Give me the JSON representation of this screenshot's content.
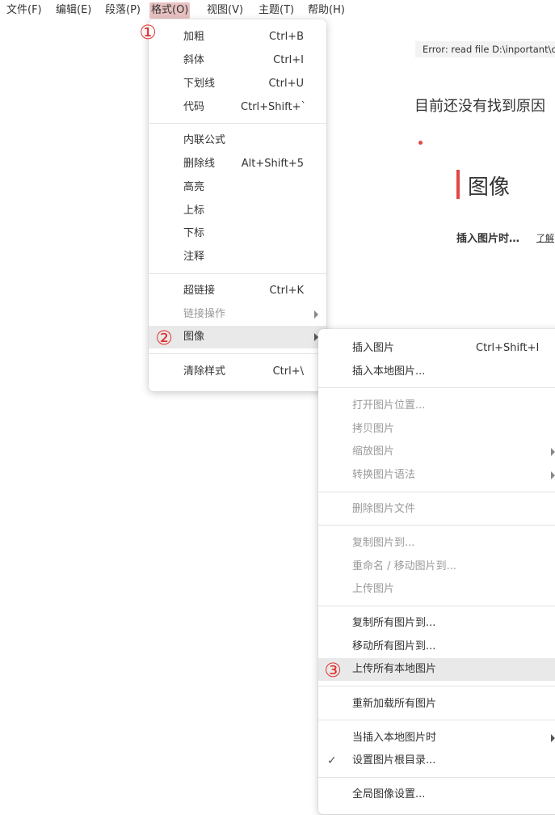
{
  "menubar": {
    "items": [
      {
        "label": "文件(F)"
      },
      {
        "label": "编辑(E)"
      },
      {
        "label": "段落(P)"
      },
      {
        "label": "格式(O)"
      },
      {
        "label": "视图(V)"
      },
      {
        "label": "主题(T)"
      },
      {
        "label": "帮助(H)"
      }
    ]
  },
  "editor": {
    "error_text": "Error: read file D:\\inportant\\c",
    "paragraph": "目前还没有找到原因",
    "heading": "图像",
    "insert_tip": "插入图片时…",
    "learn_more": "了解"
  },
  "format_menu": {
    "items": [
      {
        "label": "加粗",
        "shortcut": "Ctrl+B"
      },
      {
        "label": "斜体",
        "shortcut": "Ctrl+I"
      },
      {
        "label": "下划线",
        "shortcut": "Ctrl+U"
      },
      {
        "label": "代码",
        "shortcut": "Ctrl+Shift+`"
      },
      {
        "label": "内联公式",
        "shortcut": ""
      },
      {
        "label": "删除线",
        "shortcut": "Alt+Shift+5"
      },
      {
        "label": "高亮",
        "shortcut": ""
      },
      {
        "label": "上标",
        "shortcut": ""
      },
      {
        "label": "下标",
        "shortcut": ""
      },
      {
        "label": "注释",
        "shortcut": ""
      },
      {
        "label": "超链接",
        "shortcut": "Ctrl+K"
      },
      {
        "label": "链接操作",
        "shortcut": ""
      },
      {
        "label": "图像",
        "shortcut": ""
      },
      {
        "label": "清除样式",
        "shortcut": "Ctrl+\\"
      }
    ]
  },
  "image_menu": {
    "items": [
      {
        "label": "插入图片",
        "shortcut": "Ctrl+Shift+I"
      },
      {
        "label": "插入本地图片...",
        "shortcut": ""
      },
      {
        "label": "打开图片位置...",
        "shortcut": ""
      },
      {
        "label": "拷贝图片",
        "shortcut": ""
      },
      {
        "label": "缩放图片",
        "shortcut": ""
      },
      {
        "label": "转换图片语法",
        "shortcut": ""
      },
      {
        "label": "删除图片文件",
        "shortcut": ""
      },
      {
        "label": "复制图片到...",
        "shortcut": ""
      },
      {
        "label": "重命名 / 移动图片到...",
        "shortcut": ""
      },
      {
        "label": "上传图片",
        "shortcut": ""
      },
      {
        "label": "复制所有图片到...",
        "shortcut": ""
      },
      {
        "label": "移动所有图片到...",
        "shortcut": ""
      },
      {
        "label": "上传所有本地图片",
        "shortcut": ""
      },
      {
        "label": "重新加载所有图片",
        "shortcut": ""
      },
      {
        "label": "当插入本地图片时",
        "shortcut": ""
      },
      {
        "label": "设置图片根目录...",
        "shortcut": ""
      },
      {
        "label": "全局图像设置...",
        "shortcut": ""
      }
    ]
  },
  "annotations": {
    "step1": "①",
    "step2": "②",
    "step3": "③"
  },
  "colors": {
    "accent": "#e04848",
    "active_menu_bg": "#e8c2c2",
    "highlight_bg": "#e9e9e9",
    "disabled_text": "#9a9a9a"
  },
  "icons": {
    "submenu_arrow": "chevron-right-icon",
    "checkmark": "check-icon"
  }
}
